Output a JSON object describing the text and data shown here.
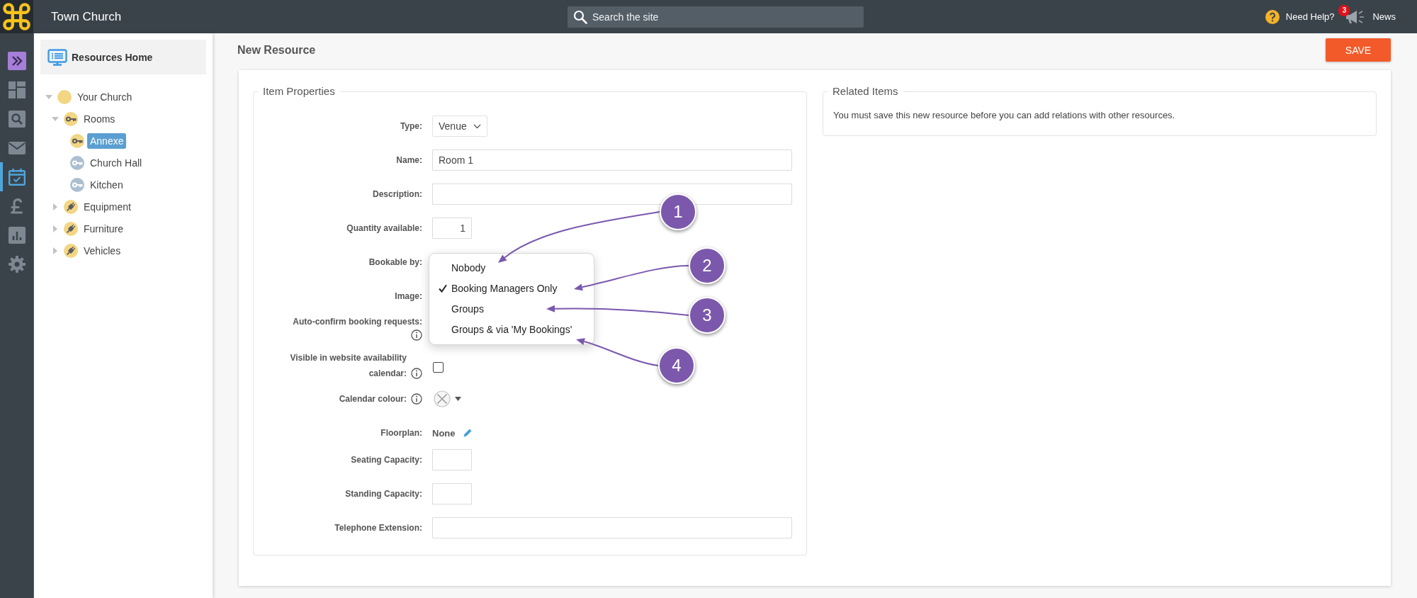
{
  "topbar": {
    "site_name": "Town Church",
    "search": {
      "placeholder": "Search the site"
    },
    "help": {
      "label": "Need Help?"
    },
    "news": {
      "label": "News",
      "badge": "3"
    }
  },
  "rail": {
    "items": [
      {
        "kind": "expand",
        "selected": false
      },
      {
        "kind": "dashboard",
        "selected": false
      },
      {
        "kind": "search",
        "selected": false
      },
      {
        "kind": "mail",
        "selected": false
      },
      {
        "kind": "calendar",
        "selected": true
      },
      {
        "kind": "pound",
        "selected": false
      },
      {
        "kind": "reports",
        "selected": false
      },
      {
        "kind": "settings",
        "selected": false
      }
    ]
  },
  "sidebar": {
    "home": {
      "label": "Resources Home"
    },
    "tree": [
      {
        "label": "Your Church",
        "kind": "plain",
        "color": "#f3d684",
        "expanded": true,
        "selected": false,
        "children": [
          {
            "label": "Rooms",
            "kind": "key",
            "color": "#f3d684",
            "expanded": true,
            "selected": false,
            "children": [
              {
                "label": "Annexe",
                "kind": "key",
                "color": "#f3d684",
                "selected": true
              },
              {
                "label": "Church Hall",
                "kind": "key",
                "color": "#abbfd0",
                "selected": false
              },
              {
                "label": "Kitchen",
                "kind": "key",
                "color": "#abbfd0",
                "selected": false
              }
            ]
          },
          {
            "label": "Equipment",
            "kind": "plug",
            "color": "#f3d684",
            "expanded": false,
            "selected": false
          },
          {
            "label": "Furniture",
            "kind": "plug",
            "color": "#f3d684",
            "expanded": false,
            "selected": false
          },
          {
            "label": "Vehicles",
            "kind": "plug",
            "color": "#f3d684",
            "expanded": false,
            "selected": false
          }
        ]
      }
    ]
  },
  "page": {
    "title": "New Resource",
    "save_button": "SAVE"
  },
  "item_properties": {
    "title": "Item Properties",
    "fields": [
      {
        "kind": "select",
        "label": "Type:",
        "value": "Venue",
        "info": false
      },
      {
        "kind": "text",
        "label": "Name:",
        "value": "Room 1",
        "info": false
      },
      {
        "kind": "text",
        "label": "Description:",
        "info": false
      },
      {
        "kind": "number",
        "label": "Quantity available:",
        "value": "1",
        "info": false
      },
      {
        "kind": "covered",
        "label": "Bookable by:",
        "info": false
      },
      {
        "kind": "covered",
        "label": "Image:",
        "info": false
      },
      {
        "kind": "covered",
        "label": "Auto-confirm booking requests:",
        "info": true
      },
      {
        "kind": "checkbox",
        "label": "Visible in website availability calendar:",
        "info": true,
        "checked": false
      },
      {
        "kind": "colour",
        "label": "Calendar colour:",
        "info": true
      },
      {
        "kind": "link",
        "label": "Floorplan:",
        "value": "None",
        "info": false
      },
      {
        "kind": "number",
        "label": "Seating Capacity:",
        "info": false
      },
      {
        "kind": "number",
        "label": "Standing Capacity:",
        "info": false
      },
      {
        "kind": "text",
        "label": "Telephone Extension:",
        "info": false
      }
    ]
  },
  "related_items": {
    "title": "Related Items",
    "message": "You must save this new resource before you can add relations with other resources."
  },
  "dropdown_menu": {
    "items": [
      {
        "label": "Nobody",
        "selected": false
      },
      {
        "label": "Booking Managers Only",
        "selected": true
      },
      {
        "label": "Groups",
        "selected": false
      },
      {
        "label": "Groups & via 'My Bookings'",
        "selected": false
      }
    ]
  },
  "callouts": [
    {
      "label": "1"
    },
    {
      "label": "2"
    },
    {
      "label": "3"
    },
    {
      "label": "4"
    }
  ]
}
